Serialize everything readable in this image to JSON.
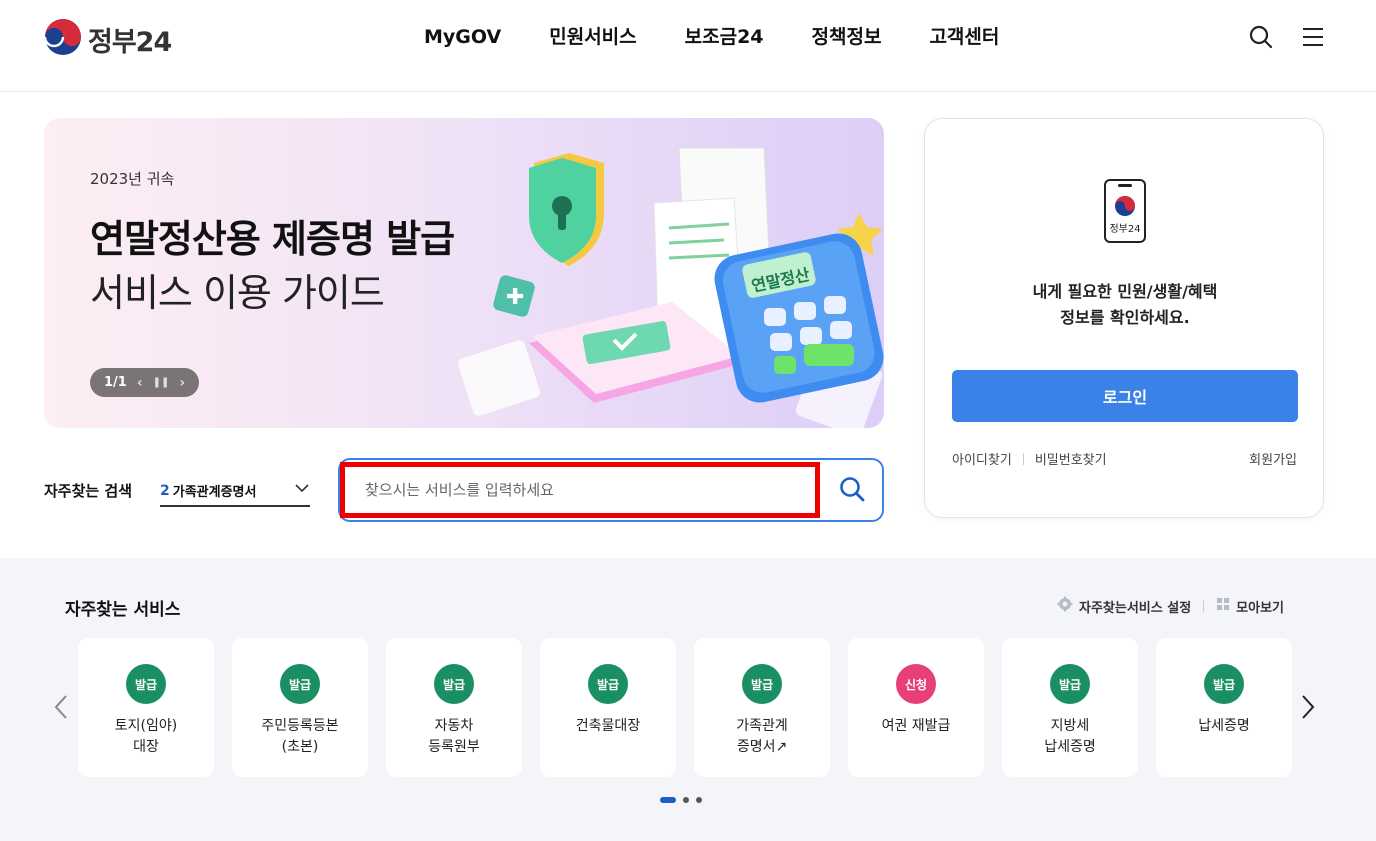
{
  "header": {
    "logo_text": "정부24",
    "nav": [
      "MyGOV",
      "민원서비스",
      "보조금24",
      "정책정보",
      "고객센터"
    ],
    "icons": [
      "search-icon",
      "menu-icon"
    ]
  },
  "banner": {
    "subtitle": "2023년 귀속",
    "title": "연말정산용 제증명 발급",
    "title2": "서비스 이용 가이드",
    "counter": "1/1",
    "calculator_text": "연말정산"
  },
  "login": {
    "phone_label": "정부24",
    "desc_line1": "내게 필요한 민원/생활/혜택",
    "desc_line2": "정보를 확인하세요.",
    "login_button": "로그인",
    "find_id": "아이디찾기",
    "find_pw": "비밀번호찾기",
    "join": "회원가입"
  },
  "search": {
    "freq_label": "자주찾는 검색",
    "freq_rank": "2",
    "freq_value": "가족관계증명서",
    "placeholder": "찾으시는 서비스를 입력하세요"
  },
  "services": {
    "title": "자주찾는 서비스",
    "settings": "자주찾는서비스 설정",
    "view_all": "모아보기",
    "colors": {
      "issue": "#1a8f64",
      "apply": "#e83e7a"
    },
    "items": [
      {
        "badge": "발급",
        "line1": "토지(임야)",
        "line2": "대장"
      },
      {
        "badge": "발급",
        "line1": "주민등록등본",
        "line2": "(초본)"
      },
      {
        "badge": "발급",
        "line1": "자동차",
        "line2": "등록원부"
      },
      {
        "badge": "발급",
        "line1": "건축물대장",
        "line2": ""
      },
      {
        "badge": "발급",
        "line1": "가족관계",
        "line2": "증명서↗"
      },
      {
        "badge": "신청",
        "line1": "여권 재발급",
        "line2": ""
      },
      {
        "badge": "발급",
        "line1": "지방세",
        "line2": "납세증명"
      },
      {
        "badge": "발급",
        "line1": "납세증명",
        "line2": ""
      }
    ],
    "page_dots": 3,
    "active_dot": 1
  }
}
